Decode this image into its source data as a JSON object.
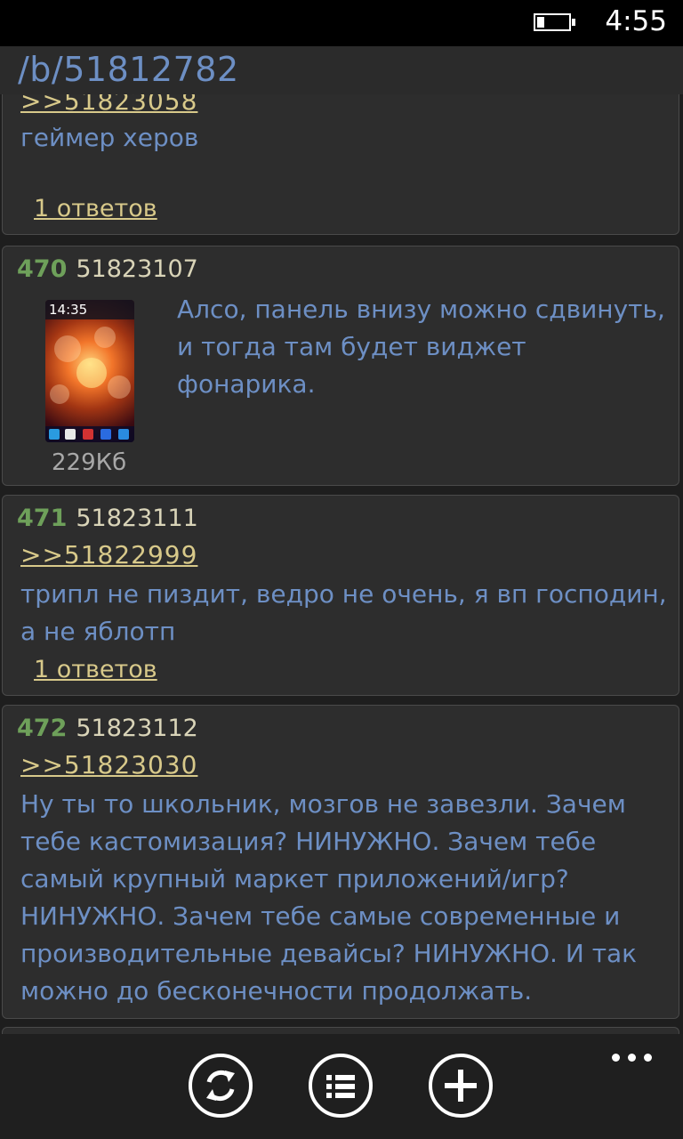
{
  "status": {
    "time": "4:55"
  },
  "header": {
    "title": "/b/51812782"
  },
  "posts": [
    {
      "quote": ">>51823058",
      "text": "геймер херов",
      "replies": "1 ответов"
    },
    {
      "number": "470",
      "id": "51823107",
      "text": "Алсо, панель внизу можно сдвинуть, и тогда там будет виджет фонарика.",
      "image_size": "229Кб",
      "thumb_time": "14:35"
    },
    {
      "number": "471",
      "id": "51823111",
      "quote": ">>51822999",
      "text": "трипл не пиздит, ведро не очень, я вп господин, а не яблотп",
      "replies": "1 ответов"
    },
    {
      "number": "472",
      "id": "51823112",
      "quote": ">>51823030",
      "text": "Ну ты то школьник, мозгов не завезли. Зачем тебе кастомизация? НИНУЖНО. Зачем тебе самый крупный маркет приложений/игр? НИНУЖНО. Зачем тебе самые современные и производительные девайсы? НИНУЖНО. И так можно до бесконечности продолжать."
    }
  ],
  "app_bar": {
    "icons": [
      "refresh-icon",
      "list-icon",
      "add-icon",
      "more-icon"
    ]
  },
  "colors": {
    "post_text": "#6d8fc4",
    "link": "#d8c98a",
    "post_number": "#6ea05a",
    "post_background": "#2d2d2d"
  }
}
